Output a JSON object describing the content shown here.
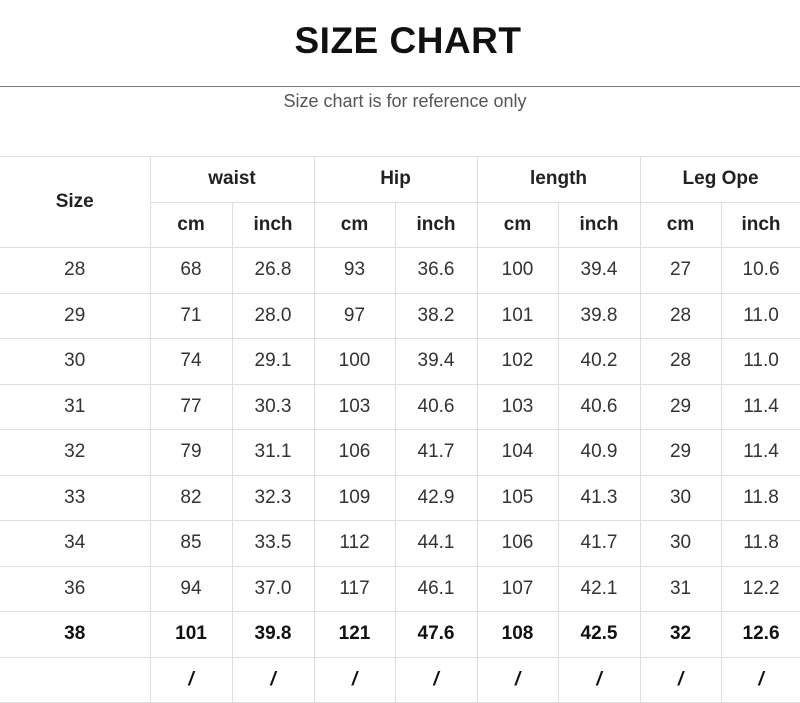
{
  "title": "SIZE CHART",
  "subtitle": "Size chart is for reference only",
  "table": {
    "size_header": "Size",
    "groups": [
      "waist",
      "Hip",
      "length",
      "Leg Ope"
    ],
    "units": [
      "cm",
      "inch",
      "cm",
      "inch",
      "cm",
      "inch",
      "cm",
      "inch"
    ],
    "rows": [
      [
        "28",
        "68",
        "26.8",
        "93",
        "36.6",
        "100",
        "39.4",
        "27",
        "10.6"
      ],
      [
        "29",
        "71",
        "28.0",
        "97",
        "38.2",
        "101",
        "39.8",
        "28",
        "11.0"
      ],
      [
        "30",
        "74",
        "29.1",
        "100",
        "39.4",
        "102",
        "40.2",
        "28",
        "11.0"
      ],
      [
        "31",
        "77",
        "30.3",
        "103",
        "40.6",
        "103",
        "40.6",
        "29",
        "11.4"
      ],
      [
        "32",
        "79",
        "31.1",
        "106",
        "41.7",
        "104",
        "40.9",
        "29",
        "11.4"
      ],
      [
        "33",
        "82",
        "32.3",
        "109",
        "42.9",
        "105",
        "41.3",
        "30",
        "11.8"
      ],
      [
        "34",
        "85",
        "33.5",
        "112",
        "44.1",
        "106",
        "41.7",
        "30",
        "11.8"
      ],
      [
        "36",
        "94",
        "37.0",
        "117",
        "46.1",
        "107",
        "42.1",
        "31",
        "12.2"
      ],
      [
        "38",
        "101",
        "39.8",
        "121",
        "47.6",
        "108",
        "42.5",
        "32",
        "12.6"
      ],
      [
        "",
        "/",
        "/",
        "/",
        "/",
        "/",
        "/",
        "/",
        "/"
      ]
    ]
  }
}
